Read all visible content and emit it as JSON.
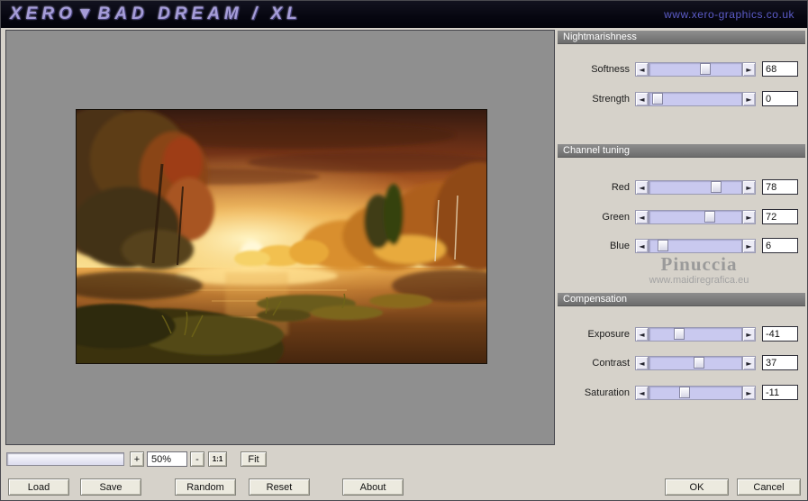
{
  "titlebar": {
    "title": "XERO▼BAD DREAM / XL",
    "link": "www.xero-graphics.co.uk"
  },
  "sections": {
    "nightmarishness": {
      "header": "Nightmarishness",
      "sliders": [
        {
          "label": "Softness",
          "value": "68",
          "thumb_pct": 62
        },
        {
          "label": "Strength",
          "value": "0",
          "thumb_pct": 3
        }
      ]
    },
    "channel_tuning": {
      "header": "Channel tuning",
      "sliders": [
        {
          "label": "Red",
          "value": "78",
          "thumb_pct": 76
        },
        {
          "label": "Green",
          "value": "72",
          "thumb_pct": 68
        },
        {
          "label": "Blue",
          "value": "6",
          "thumb_pct": 10
        }
      ]
    },
    "compensation": {
      "header": "Compensation",
      "sliders": [
        {
          "label": "Exposure",
          "value": "-41",
          "thumb_pct": 30
        },
        {
          "label": "Contrast",
          "value": "37",
          "thumb_pct": 54
        },
        {
          "label": "Saturation",
          "value": "-11",
          "thumb_pct": 37
        }
      ]
    }
  },
  "watermark": {
    "name": "Pinuccia",
    "url": "www.maidiregrafica.eu"
  },
  "toolbar": {
    "zoom_in": "+",
    "zoom_value": "50%",
    "zoom_out": "-",
    "actual_size": "1:1",
    "fit": "Fit"
  },
  "icons": {
    "arrow_left": "◄",
    "arrow_right": "►"
  },
  "buttons": {
    "load": "Load",
    "save": "Save",
    "random": "Random",
    "reset": "Reset",
    "about": "About",
    "ok": "OK",
    "cancel": "Cancel"
  },
  "colors": {
    "titlebar_bg": "#06060f",
    "title_text": "#a59cd8",
    "slider_track": "#c9c9ef",
    "panel_bg": "#d6d2ca",
    "preview_bg": "#8f8f8f"
  }
}
